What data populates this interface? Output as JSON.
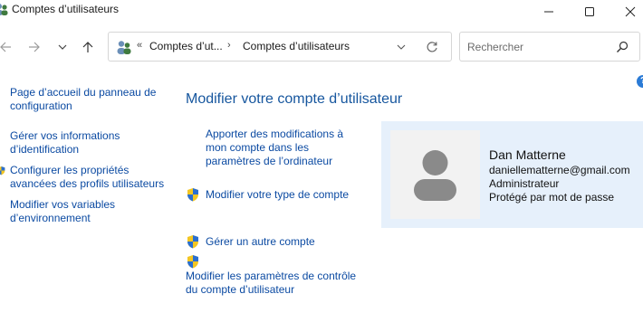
{
  "window": {
    "title": "Comptes d’utilisateurs"
  },
  "address": {
    "crumb_overflow": "«",
    "crumb1": "Comptes d’ut...",
    "separator": "›",
    "crumb2": "Comptes d’utilisateurs"
  },
  "search": {
    "placeholder": "Rechercher"
  },
  "help": {
    "label": "?"
  },
  "sidebar": {
    "items": [
      {
        "label": "Page d’accueil du panneau de configuration"
      },
      {
        "label": "Gérer vos informations d’identification"
      },
      {
        "label": "Configurer les propriétés avancées des profils utilisateurs"
      },
      {
        "label": "Modifier vos variables d’environnement"
      }
    ]
  },
  "main": {
    "heading": "Modifier votre compte d’utilisateur",
    "tasks": [
      {
        "label": "Apporter des modifications à mon compte dans les paramètres de l’ordinateur"
      },
      {
        "label": "Modifier votre type de compte"
      },
      {
        "label": "Gérer un autre compte"
      },
      {
        "label": "Modifier les paramètres de contrôle du compte d’utilisateur"
      }
    ]
  },
  "account": {
    "name": "Dan Matterne",
    "email": "daniellematterne@gmail.com",
    "role": "Administrateur",
    "protection": "Protégé par mot de passe"
  },
  "colors": {
    "link": "#0b4aa2",
    "heading": "#16569e",
    "card_background": "#e6f0fb",
    "avatar_silhouette": "#8a8a8a",
    "shield_blue": "#2a6fd1",
    "shield_yellow": "#f3c623"
  },
  "icons": {
    "window": "users-icon",
    "address": "users-icon",
    "nav": [
      "back-arrow-icon",
      "forward-arrow-icon",
      "chevron-down-icon",
      "up-arrow-icon"
    ],
    "refresh": "refresh-icon",
    "search": "search-icon",
    "uac": "uac-shield-icon"
  }
}
